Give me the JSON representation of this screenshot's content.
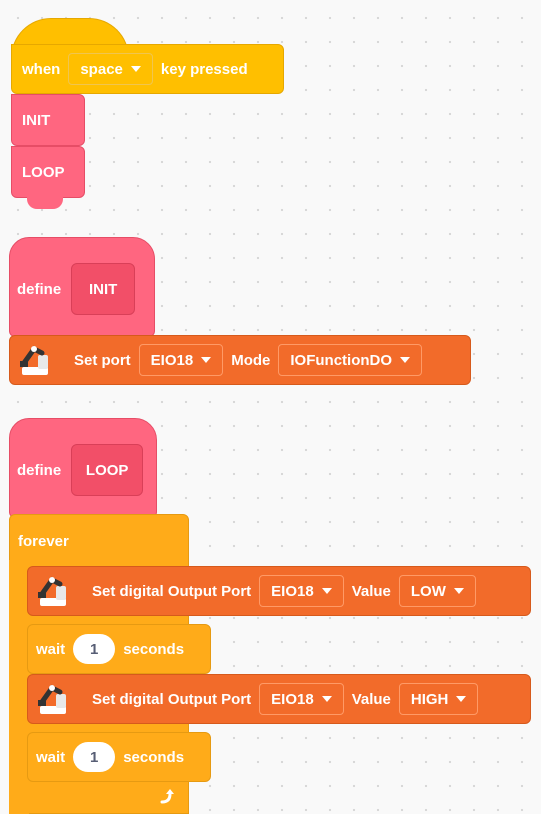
{
  "script1": {
    "hat_when": "when",
    "hat_key": "space",
    "hat_pressed": "key pressed",
    "call_init": "INIT",
    "call_loop": "LOOP"
  },
  "define_init": {
    "define_label": "define",
    "name": "INIT",
    "set_port_label": "Set port",
    "port_value": "EIO18",
    "mode_label": "Mode",
    "mode_value": "IOFunctionDO"
  },
  "define_loop": {
    "define_label": "define",
    "name": "LOOP",
    "forever_label": "forever",
    "step1": {
      "label": "Set digital Output Port",
      "port": "EIO18",
      "value_label": "Value",
      "value": "LOW"
    },
    "wait1": {
      "label": "wait",
      "amount": "1",
      "unit": "seconds"
    },
    "step2": {
      "label": "Set digital Output Port",
      "port": "EIO18",
      "value_label": "Value",
      "value": "HIGH"
    },
    "wait2": {
      "label": "wait",
      "amount": "1",
      "unit": "seconds"
    },
    "loop_arrow_icon": "loop-arrow-icon"
  },
  "colors": {
    "event": "#ffbf00",
    "custom": "#ff6680",
    "robot": "#f26b2a",
    "control": "#ffab19"
  }
}
